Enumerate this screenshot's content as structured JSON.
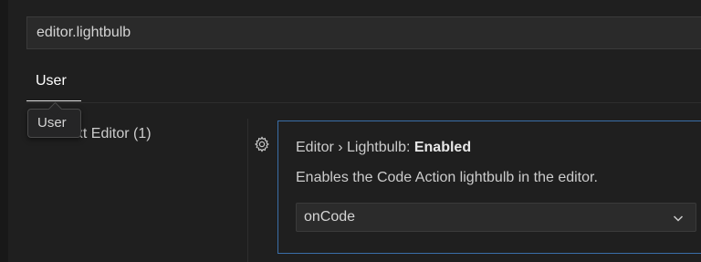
{
  "search": {
    "value": "editor.lightbulb"
  },
  "tabs": [
    {
      "label": "User"
    }
  ],
  "tooltip": {
    "text": "User"
  },
  "toc": {
    "items": [
      {
        "label": "Text Editor (1)"
      }
    ]
  },
  "setting": {
    "category": "Editor › Lightbulb: ",
    "name": "Enabled",
    "description": "Enables the Code Action lightbulb in the editor.",
    "value": "onCode"
  },
  "icons": {
    "gear": "gear-icon",
    "chevron": "chevron-down-icon"
  },
  "colors": {
    "focus_border": "#3a6ea8",
    "background": "#1f1f1f"
  }
}
